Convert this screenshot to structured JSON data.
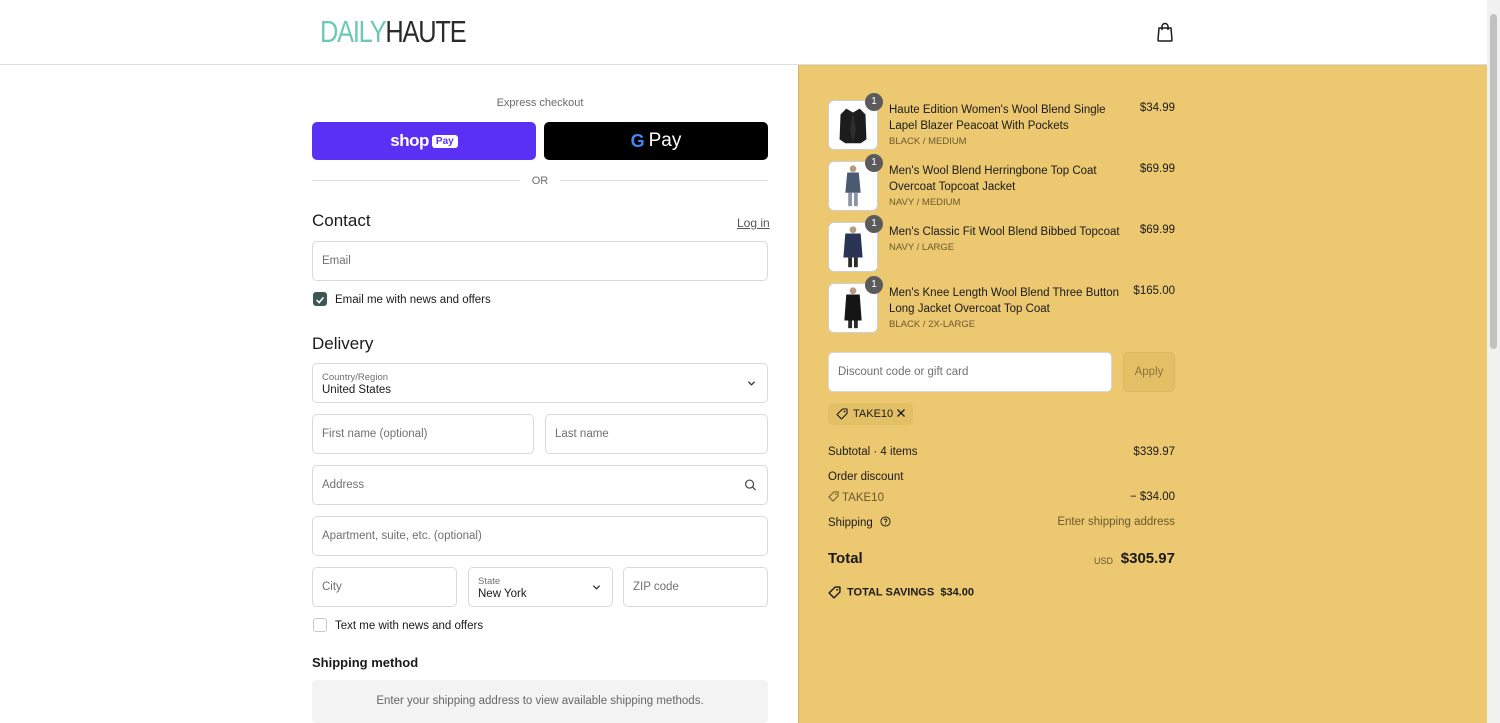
{
  "header": {
    "logo_part1": "DAILY",
    "logo_part2": "HAUTE",
    "cart_icon": "shopping-bag-icon"
  },
  "express": {
    "label": "Express checkout",
    "shop_pay": {
      "shop": "shop",
      "pay": "Pay"
    },
    "google_pay": {
      "g": "G",
      "pay": "Pay"
    },
    "or": "OR"
  },
  "contact": {
    "title": "Contact",
    "login": "Log in",
    "email_placeholder": "Email",
    "news_label": "Email me with news and offers",
    "news_checked": true
  },
  "delivery": {
    "title": "Delivery",
    "country_label": "Country/Region",
    "country_value": "United States",
    "first_name_placeholder": "First name (optional)",
    "last_name_placeholder": "Last name",
    "address_placeholder": "Address",
    "apartment_placeholder": "Apartment, suite, etc. (optional)",
    "city_placeholder": "City",
    "state_label": "State",
    "state_value": "New York",
    "zip_placeholder": "ZIP code",
    "text_label": "Text me with news and offers",
    "text_checked": false
  },
  "shipping_method": {
    "title": "Shipping method",
    "message": "Enter your shipping address to view available shipping methods."
  },
  "order": {
    "items": [
      {
        "qty": "1",
        "name": "Haute Edition Women's Wool Blend Single Lapel Blazer Peacoat With Pockets",
        "variant": "BLACK / MEDIUM",
        "price": "$34.99"
      },
      {
        "qty": "1",
        "name": "Men's Wool Blend Herringbone Top Coat Overcoat Topcoat Jacket",
        "variant": "NAVY / MEDIUM",
        "price": "$69.99"
      },
      {
        "qty": "1",
        "name": "Men's Classic Fit Wool Blend Bibbed Topcoat",
        "variant": "NAVY / LARGE",
        "price": "$69.99"
      },
      {
        "qty": "1",
        "name": "Men's Knee Length Wool Blend Three Button Long Jacket Overcoat Top Coat",
        "variant": "BLACK / 2X-LARGE",
        "price": "$165.00"
      }
    ],
    "discount_placeholder": "Discount code or gift card",
    "apply": "Apply",
    "applied_code": "TAKE10",
    "subtotal_label": "Subtotal · 4 items",
    "subtotal_value": "$339.97",
    "order_discount_label": "Order discount",
    "discount_code": "TAKE10",
    "discount_value": "− $34.00",
    "shipping_label": "Shipping",
    "shipping_value": "Enter shipping address",
    "total_label": "Total",
    "currency": "USD",
    "total_value": "$305.97",
    "savings_label": "TOTAL SAVINGS",
    "savings_value": "$34.00"
  },
  "colors": {
    "summary_bg": "#ecc870",
    "shop_pay": "#5a31f4",
    "logo_accent": "#6dc8b6",
    "checkbox": "#3d5755"
  }
}
